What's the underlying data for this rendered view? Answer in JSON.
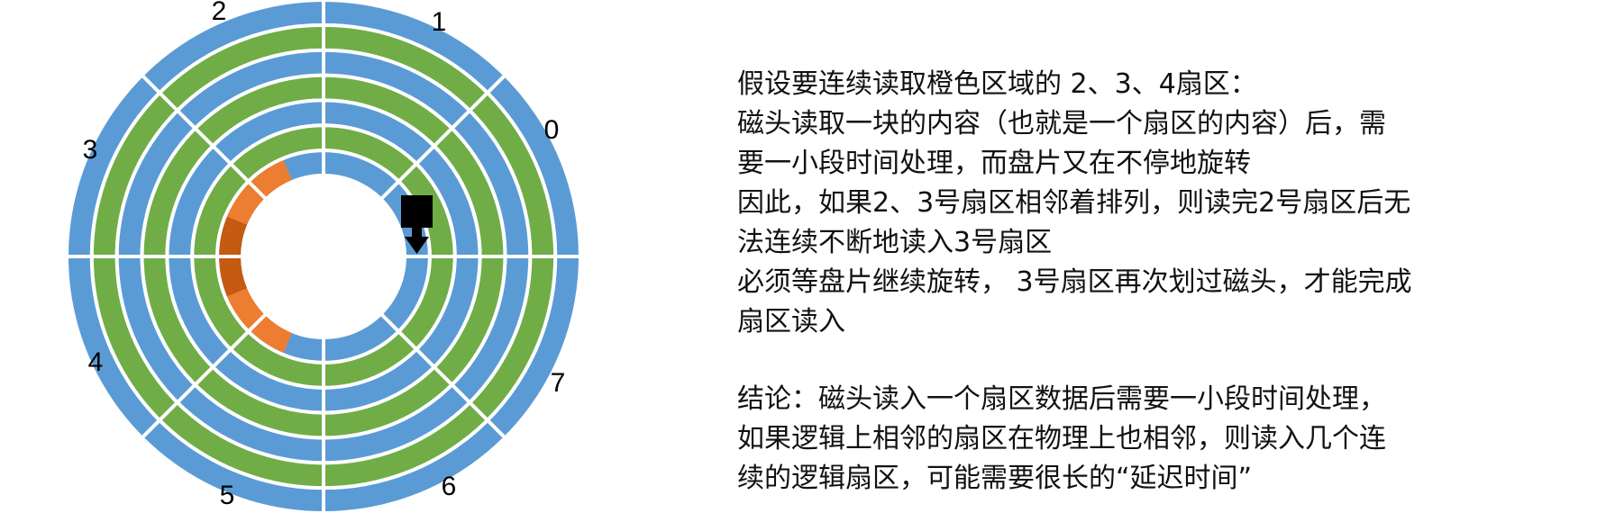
{
  "diagram": {
    "sector_labels": [
      "0",
      "1",
      "2",
      "3",
      "4",
      "5",
      "6",
      "7"
    ],
    "track_count": 7,
    "colors": {
      "outer_track": "#5b9bd5",
      "track_blue": "#5b9bd5",
      "track_green": "#70ad47",
      "highlight_orange": "#ed7d31",
      "highlight_dark_orange": "#c55a11",
      "head": "#000000",
      "separator": "#ffffff"
    },
    "highlighted_sectors": [
      "2",
      "3",
      "4"
    ],
    "head_icon": "read-head-arrow-down-icon"
  },
  "text": {
    "lines": [
      "假设要连续读取橙色区域的 2、3、4扇区：",
      "磁头读取一块的内容（也就是一个扇区的内容）后，需",
      "要一小段时间处理，而盘片又在不停地旋转",
      "因此，如果2、3号扇区相邻着排列，则读完2号扇区后无",
      "法连续不断地读入3号扇区",
      "必须等盘片继续旋转， 3号扇区再次划过磁头，才能完成",
      "扇区读入"
    ],
    "conclusion_lines": [
      "结论：磁头读入一个扇区数据后需要一小段时间处理，",
      "如果逻辑上相邻的扇区在物理上也相邻，则读入几个连",
      "续的逻辑扇区，可能需要很长的“延迟时间”"
    ]
  }
}
